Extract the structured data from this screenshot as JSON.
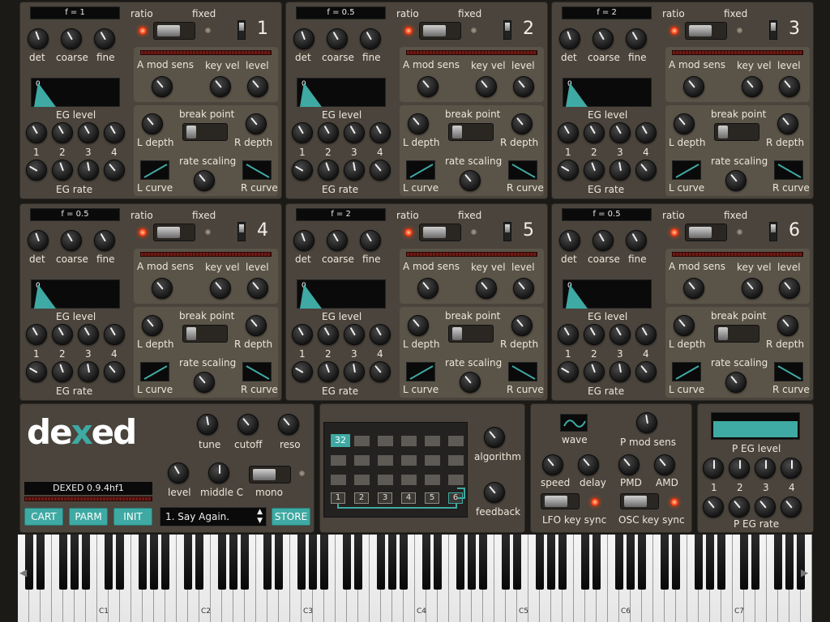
{
  "operators": [
    {
      "num": "1",
      "freq": "f = 1"
    },
    {
      "num": "2",
      "freq": "f = 0.5"
    },
    {
      "num": "3",
      "freq": "f = 2"
    },
    {
      "num": "4",
      "freq": "f = 0.5"
    },
    {
      "num": "5",
      "freq": "f = 2"
    },
    {
      "num": "6",
      "freq": "f = 0.5"
    }
  ],
  "op_labels": {
    "ratio": "ratio",
    "fixed": "fixed",
    "det": "det",
    "coarse": "coarse",
    "fine": "fine",
    "a_mod_sens": "A mod sens",
    "key_vel": "key vel",
    "level": "level",
    "eg_level": "EG level",
    "eg_rate": "EG rate",
    "eg_zero": "0",
    "break_point": "break point",
    "l_depth": "L depth",
    "r_depth": "R depth",
    "rate_scaling": "rate scaling",
    "l_curve": "L curve",
    "r_curve": "R curve",
    "s1": "1",
    "s2": "2",
    "s3": "3",
    "s4": "4"
  },
  "global": {
    "logo_a": "de",
    "logo_x": "x",
    "logo_b": "ed",
    "version": "DEXED 0.9.4hf1",
    "tune": "tune",
    "cutoff": "cutoff",
    "reso": "reso",
    "level": "level",
    "middle_c": "middle C",
    "mono": "mono",
    "cart": "CART",
    "parm": "PARM",
    "init": "INIT",
    "program": "1. Say Again.",
    "store": "STORE"
  },
  "algorithm": {
    "selected": "32",
    "label": "algorithm",
    "feedback": "feedback",
    "ops": [
      "1",
      "2",
      "3",
      "4",
      "5",
      "6"
    ]
  },
  "lfo": {
    "wave": "wave",
    "p_mod_sens": "P mod sens",
    "speed": "speed",
    "delay": "delay",
    "pmd": "PMD",
    "amd": "AMD",
    "lfo_key_sync": "LFO key sync",
    "osc_key_sync": "OSC key sync"
  },
  "peg": {
    "level": "P EG level",
    "rate": "P EG rate",
    "s1": "1",
    "s2": "2",
    "s3": "3",
    "s4": "4"
  },
  "keyboard": {
    "octaves": [
      "C1",
      "C2",
      "C3",
      "C4",
      "C5",
      "C6",
      "C7"
    ]
  },
  "colors": {
    "accent": "#3fa9a3",
    "panel": "#4a443c",
    "led": "#ff3a10"
  }
}
